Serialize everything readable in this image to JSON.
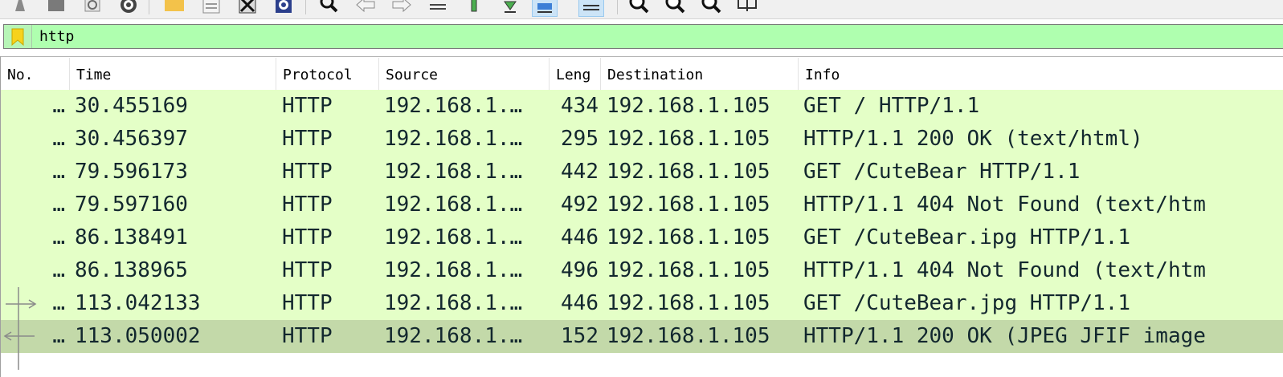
{
  "toolbar": {
    "icons": [
      "capture-options-icon",
      "close-file-icon",
      "reload-icon",
      "preferences-icon",
      "open-folder-icon",
      "binary-file-icon",
      "close-capture-icon",
      "hex-dump-icon",
      "find-packet-icon",
      "go-back-icon",
      "go-forward-icon",
      "go-to-packet-icon",
      "go-first-icon",
      "go-last-icon",
      "autoscroll-icon",
      "colorize-icon",
      "zoom-in-icon",
      "zoom-out-icon",
      "zoom-normal-icon",
      "resize-columns-icon"
    ]
  },
  "filter": {
    "value": "http",
    "valid_color": "#afffaf"
  },
  "columns": [
    "No.",
    "Time",
    "Protocol",
    "Source",
    "Leng",
    "Destination",
    "Info"
  ],
  "packets": [
    {
      "no": "…",
      "time": "30.455169",
      "protocol": "HTTP",
      "source": "192.168.1.…",
      "length": "434",
      "destination": "192.168.1.105",
      "info": "GET / HTTP/1.1"
    },
    {
      "no": "…",
      "time": "30.456397",
      "protocol": "HTTP",
      "source": "192.168.1.…",
      "length": "295",
      "destination": "192.168.1.105",
      "info": "HTTP/1.1 200 OK  (text/html)"
    },
    {
      "no": "…",
      "time": "79.596173",
      "protocol": "HTTP",
      "source": "192.168.1.…",
      "length": "442",
      "destination": "192.168.1.105",
      "info": "GET /CuteBear HTTP/1.1"
    },
    {
      "no": "…",
      "time": "79.597160",
      "protocol": "HTTP",
      "source": "192.168.1.…",
      "length": "492",
      "destination": "192.168.1.105",
      "info": "HTTP/1.1 404 Not Found  (text/htm"
    },
    {
      "no": "…",
      "time": "86.138491",
      "protocol": "HTTP",
      "source": "192.168.1.…",
      "length": "446",
      "destination": "192.168.1.105",
      "info": "GET /CuteBear.ipg HTTP/1.1"
    },
    {
      "no": "…",
      "time": "86.138965",
      "protocol": "HTTP",
      "source": "192.168.1.…",
      "length": "496",
      "destination": "192.168.1.105",
      "info": "HTTP/1.1 404 Not Found  (text/htm"
    },
    {
      "no": "…",
      "time": "113.042133",
      "protocol": "HTTP",
      "source": "192.168.1.…",
      "length": "446",
      "destination": "192.168.1.105",
      "info": "GET /CuteBear.jpg HTTP/1.1"
    },
    {
      "no": "…",
      "time": "113.050002",
      "protocol": "HTTP",
      "source": "192.168.1.…",
      "length": "152",
      "destination": "192.168.1.105",
      "info": "HTTP/1.1 200 OK  (JPEG JFIF image"
    }
  ],
  "selected_index": 7,
  "colors": {
    "row_http": "#e4ffc7",
    "row_selected": "#c3d9a9",
    "row_text": "#12272e"
  }
}
